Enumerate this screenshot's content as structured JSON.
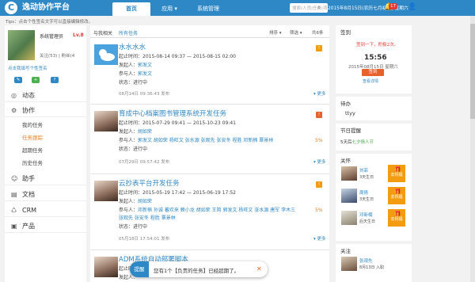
{
  "topbar": {
    "logo_char": "C",
    "brand": "逸动协作平台",
    "nav_home": "首页",
    "nav_apps": "应用 ▾",
    "nav_system": "系统管理",
    "search_placeholder": "搜索(人员|任务|项目|流程)",
    "date": "2015年8月15日(农历七月初二) 星期六",
    "notify_count": "17",
    "accent": "#2f88c6"
  },
  "tips": "Tips：点击个性签名文字可以直接编辑修改。",
  "user": {
    "name": "系统管理员",
    "level": "Lv.8",
    "follow": "关注(53)",
    "fans": "粉丝(4",
    "signature_hint": "点击我填写个性签名"
  },
  "menu": {
    "dynamic": "动态",
    "collab": "协作",
    "my_tasks": "我的任务",
    "task_tracking": "任务跟踪",
    "overdue_tasks": "超期任务",
    "history_tasks": "历史任务",
    "assistant": "助手",
    "docs": "文档",
    "crm": "CRM",
    "product": "产品"
  },
  "main": {
    "header_filter": "与我相关",
    "header_all": "所有任务",
    "sort": "排序 ▾",
    "filter": "筛选 ▾",
    "count": "共6条",
    "more": "▾ 更多"
  },
  "tasks": [
    {
      "title": "水水水水",
      "time": "起止时间：2015-08-14 09:37 — 2015-08-15 02:00",
      "initiator_label": "发起人：",
      "initiator": "郭发文",
      "participants_label": "参与人：",
      "participants": "郭发文",
      "status": "状态：进行中",
      "updated": "08月14日 09:36:43 发布",
      "flag": "!",
      "progress": ""
    },
    {
      "title": "育成中心档案图书管理系统开发任务",
      "time": "起止时间：2015-07-29 09:41 — 2015-10-23 09:41",
      "initiator_label": "发起人：",
      "initiator": "胡如荣",
      "participants_label": "参与人：",
      "participants": "郭发文 胡如荣 杨旺文 张水源 张观先 张安冬 程胜 邓新楠 覃景林",
      "status": "状态：进行中",
      "updated": "07月29日 09:57:42 发布",
      "flag": "!",
      "progress": "5%"
    },
    {
      "title": "云抄表平台开发任务",
      "time": "起止时间：2015-05-19 17:42 — 2015-06-19 17:52",
      "initiator_label": "发起人：",
      "initiator": "胡如荣",
      "participants_label": "参与人：",
      "participants": "邓新楠 孙诚 蕃欢来 赖小龙 胡如荣 王简 郭发文 杨旺文 张水源 唐军 李木三",
      "participants2": "张观先 张安冬 程胜 覃景林",
      "status": "状态：进行中",
      "updated": "05月18日 17:54:01 发布",
      "flag": "!",
      "progress": "5%"
    },
    {
      "title": "ADM系统自动部署脚本",
      "time": "起止时间：",
      "initiator_label": "发起人：",
      "initiator": "",
      "participants_label": "",
      "participants": "",
      "status": "",
      "updated": "",
      "flag": "",
      "progress": ""
    }
  ],
  "right": {
    "signin_title": "签到",
    "signin_text": "签到一下，积极2次。",
    "signin_time": "15:56",
    "signin_date": "2015年08月15日 星期六",
    "signin_button": "签到",
    "signin_link": "查看详情",
    "todo_title": "待办",
    "todo_item": "ttyy",
    "holiday_title": "节日提醒",
    "holiday_prefix": "5天后",
    "holiday_name": "七夕情人节",
    "care_title": "关怀",
    "care": [
      {
        "name": "刘菲",
        "sub": "3天生日",
        "btn": "去祝福"
      },
      {
        "name": "周倩",
        "sub": "3天生日",
        "btn": "去祝福"
      },
      {
        "name": "邓新楠",
        "sub": "后天生日",
        "btn": "去祝福"
      }
    ],
    "follow_title": "关注",
    "follow_name": "张观先",
    "follow_date": "8月13日 入职"
  },
  "toast": {
    "badge": "提醒",
    "message": "您有1个【负责的任务】已经超期了。",
    "close": "✕"
  }
}
